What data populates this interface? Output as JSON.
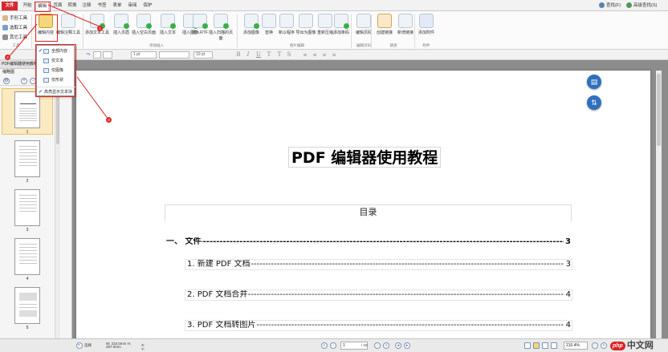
{
  "menubar": {
    "file": "文件",
    "tabs": [
      "开始",
      "编辑",
      "页面",
      "转换",
      "注释",
      "书签",
      "表单",
      "审阅",
      "保护"
    ],
    "active_tab": "编辑",
    "right": [
      "查找(F)",
      "高级查找(S)"
    ]
  },
  "ribbon": {
    "small_tools": [
      "手形工具",
      "选取工具",
      "其它工具"
    ],
    "tools_group": "工具",
    "buttons": [
      "编辑内容",
      "编辑注释工具",
      "添加文本工具",
      "插入页眉",
      "插入空白页面",
      "插入文本",
      "插入图像",
      "插入RTF",
      "插入扫描的页面",
      "添加图像",
      "替换",
      "新以程序",
      "导出为图像",
      "重新压缩",
      "添加条码",
      "编辑页码",
      "创建链接",
      "新增链接",
      "添加附件"
    ],
    "groups": [
      "添加插入",
      "图片编辑",
      "编辑页码",
      "链接",
      "附件"
    ]
  },
  "format_toolbar": {
    "font_style": "1 pt",
    "font_size": "10 pt",
    "style_buttons": [
      "B",
      "I",
      "U",
      "T",
      "T",
      "S"
    ]
  },
  "dropdown": {
    "items": [
      "全部内容",
      "仅文本",
      "仅图像",
      "仅形状"
    ],
    "last": "高亮显示文本块"
  },
  "left_panel": {
    "title": "PDF编辑器使用教程",
    "header": "缩略图",
    "thumbnails": [
      "1",
      "2",
      "3",
      "4",
      "5"
    ]
  },
  "document": {
    "title": "PDF 编辑器使用教程",
    "toc_heading": "目录",
    "toc": [
      {
        "label": "一、  文件",
        "page": "3"
      },
      {
        "label": "1.  新建 PDF 文档",
        "page": "3"
      },
      {
        "label": "2. PDF 文档合并",
        "page": "4"
      },
      {
        "label": "3. PDF 文档转图片",
        "page": "4"
      }
    ],
    "dots": "------------------------------------------------------------------------------------------------------------------------------------------------------------------------------------------------------------------------------------------------------"
  },
  "statusbar": {
    "select": "选择",
    "dims": "W: 210.0mm  H: 297.0mm",
    "x": "X:",
    "y": "Y:",
    "page_current": "1",
    "page_total": "/ 10",
    "zoom": "210.4%"
  },
  "watermark": {
    "php": "php",
    "text": "中文网"
  },
  "annotations": [
    "1",
    "2",
    "3"
  ],
  "colors": {
    "file_red": "#d8262d",
    "annotation_red": "#e02525",
    "fab_blue": "#2f6fbf"
  }
}
